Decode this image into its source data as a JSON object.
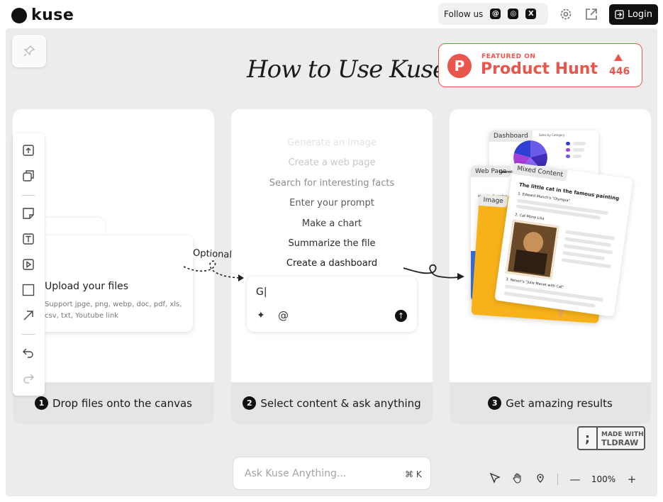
{
  "brand": {
    "name": "kuse"
  },
  "header": {
    "follow_label": "Follow us",
    "socials": [
      {
        "icon": "threads-icon",
        "glyph": "@"
      },
      {
        "icon": "instagram-icon",
        "glyph": "◎"
      },
      {
        "icon": "x-icon",
        "glyph": "X"
      }
    ],
    "login_label": "Login"
  },
  "main": {
    "headline": "How to Use Kuse?",
    "producthunt": {
      "small": "FEATURED ON",
      "big": "Product Hunt",
      "count": "446",
      "logo_letter": "P"
    }
  },
  "steps": [
    {
      "num": "1",
      "label": "Drop files onto the canvas"
    },
    {
      "num": "2",
      "label": "Select content & ask anything"
    },
    {
      "num": "3",
      "label": "Get amazing results"
    }
  ],
  "upload": {
    "title": "Upload your files",
    "subtitle": "Support jpge, png, webp, doc, pdf, xls, csv, txt, Youtube link",
    "optional": "Optional"
  },
  "prompts": [
    {
      "text": "Generate an image",
      "color": "#e2e2e2"
    },
    {
      "text": "Create a web page",
      "color": "#c7c7c7"
    },
    {
      "text": "Search for interesting facts",
      "color": "#8d8d8d"
    },
    {
      "text": "Enter your prompt",
      "color": "#5a5a5a"
    },
    {
      "text": "Make a chart",
      "color": "#3c3c3c"
    },
    {
      "text": "Summarize the file",
      "color": "#2a2a2a"
    },
    {
      "text": "Create a dashboard",
      "color": "#1b1b1b"
    }
  ],
  "prompt_input": {
    "value": "G|"
  },
  "results": {
    "dashboard_tag": "Dashboard",
    "webpage_tag": "Web Page",
    "image_tag": "Image",
    "mixed_tag": "Mixed Content",
    "mixed_title": "The little cat in the famous painting",
    "mixed_item1": "1. Edward Munch's \"Olympia\"",
    "mixed_item2": "2. Cat Mona Lisa",
    "mixed_item3": "3. Renoir's \"Julie Manet with Cat\"",
    "dashboard_chart_title": "Sales by Category",
    "web_heading": "Learning a",
    "web_sub": "About the Promotion"
  },
  "tldraw": {
    "line1": "MADE WITH",
    "line2": "TLDRAW"
  },
  "ask": {
    "placeholder": "Ask Kuse Anything...",
    "shortcut": "⌘ K"
  },
  "zoom": {
    "value": "100%"
  },
  "colors": {
    "accent": "#e9564c",
    "canvas": "#ececec",
    "footer": "#e5e5e5",
    "card_orange": "#f7b21a"
  }
}
